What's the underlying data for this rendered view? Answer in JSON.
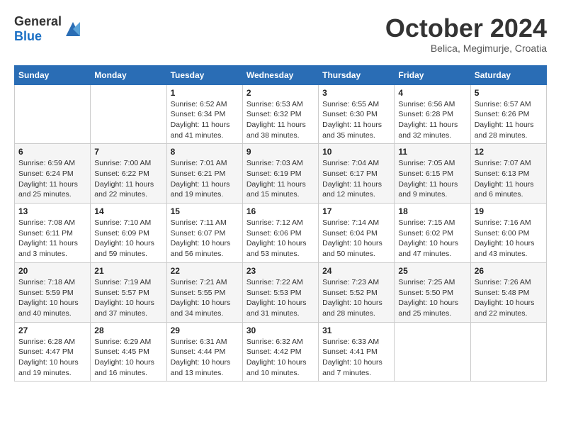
{
  "header": {
    "logo_general": "General",
    "logo_blue": "Blue",
    "month": "October 2024",
    "location": "Belica, Megimurje, Croatia"
  },
  "days_of_week": [
    "Sunday",
    "Monday",
    "Tuesday",
    "Wednesday",
    "Thursday",
    "Friday",
    "Saturday"
  ],
  "weeks": [
    [
      {
        "day": null
      },
      {
        "day": null
      },
      {
        "day": "1",
        "sunrise": "6:52 AM",
        "sunset": "6:34 PM",
        "daylight": "11 hours and 41 minutes."
      },
      {
        "day": "2",
        "sunrise": "6:53 AM",
        "sunset": "6:32 PM",
        "daylight": "11 hours and 38 minutes."
      },
      {
        "day": "3",
        "sunrise": "6:55 AM",
        "sunset": "6:30 PM",
        "daylight": "11 hours and 35 minutes."
      },
      {
        "day": "4",
        "sunrise": "6:56 AM",
        "sunset": "6:28 PM",
        "daylight": "11 hours and 32 minutes."
      },
      {
        "day": "5",
        "sunrise": "6:57 AM",
        "sunset": "6:26 PM",
        "daylight": "11 hours and 28 minutes."
      }
    ],
    [
      {
        "day": "6",
        "sunrise": "6:59 AM",
        "sunset": "6:24 PM",
        "daylight": "11 hours and 25 minutes."
      },
      {
        "day": "7",
        "sunrise": "7:00 AM",
        "sunset": "6:22 PM",
        "daylight": "11 hours and 22 minutes."
      },
      {
        "day": "8",
        "sunrise": "7:01 AM",
        "sunset": "6:21 PM",
        "daylight": "11 hours and 19 minutes."
      },
      {
        "day": "9",
        "sunrise": "7:03 AM",
        "sunset": "6:19 PM",
        "daylight": "11 hours and 15 minutes."
      },
      {
        "day": "10",
        "sunrise": "7:04 AM",
        "sunset": "6:17 PM",
        "daylight": "11 hours and 12 minutes."
      },
      {
        "day": "11",
        "sunrise": "7:05 AM",
        "sunset": "6:15 PM",
        "daylight": "11 hours and 9 minutes."
      },
      {
        "day": "12",
        "sunrise": "7:07 AM",
        "sunset": "6:13 PM",
        "daylight": "11 hours and 6 minutes."
      }
    ],
    [
      {
        "day": "13",
        "sunrise": "7:08 AM",
        "sunset": "6:11 PM",
        "daylight": "11 hours and 3 minutes."
      },
      {
        "day": "14",
        "sunrise": "7:10 AM",
        "sunset": "6:09 PM",
        "daylight": "10 hours and 59 minutes."
      },
      {
        "day": "15",
        "sunrise": "7:11 AM",
        "sunset": "6:07 PM",
        "daylight": "10 hours and 56 minutes."
      },
      {
        "day": "16",
        "sunrise": "7:12 AM",
        "sunset": "6:06 PM",
        "daylight": "10 hours and 53 minutes."
      },
      {
        "day": "17",
        "sunrise": "7:14 AM",
        "sunset": "6:04 PM",
        "daylight": "10 hours and 50 minutes."
      },
      {
        "day": "18",
        "sunrise": "7:15 AM",
        "sunset": "6:02 PM",
        "daylight": "10 hours and 47 minutes."
      },
      {
        "day": "19",
        "sunrise": "7:16 AM",
        "sunset": "6:00 PM",
        "daylight": "10 hours and 43 minutes."
      }
    ],
    [
      {
        "day": "20",
        "sunrise": "7:18 AM",
        "sunset": "5:59 PM",
        "daylight": "10 hours and 40 minutes."
      },
      {
        "day": "21",
        "sunrise": "7:19 AM",
        "sunset": "5:57 PM",
        "daylight": "10 hours and 37 minutes."
      },
      {
        "day": "22",
        "sunrise": "7:21 AM",
        "sunset": "5:55 PM",
        "daylight": "10 hours and 34 minutes."
      },
      {
        "day": "23",
        "sunrise": "7:22 AM",
        "sunset": "5:53 PM",
        "daylight": "10 hours and 31 minutes."
      },
      {
        "day": "24",
        "sunrise": "7:23 AM",
        "sunset": "5:52 PM",
        "daylight": "10 hours and 28 minutes."
      },
      {
        "day": "25",
        "sunrise": "7:25 AM",
        "sunset": "5:50 PM",
        "daylight": "10 hours and 25 minutes."
      },
      {
        "day": "26",
        "sunrise": "7:26 AM",
        "sunset": "5:48 PM",
        "daylight": "10 hours and 22 minutes."
      }
    ],
    [
      {
        "day": "27",
        "sunrise": "6:28 AM",
        "sunset": "4:47 PM",
        "daylight": "10 hours and 19 minutes."
      },
      {
        "day": "28",
        "sunrise": "6:29 AM",
        "sunset": "4:45 PM",
        "daylight": "10 hours and 16 minutes."
      },
      {
        "day": "29",
        "sunrise": "6:31 AM",
        "sunset": "4:44 PM",
        "daylight": "10 hours and 13 minutes."
      },
      {
        "day": "30",
        "sunrise": "6:32 AM",
        "sunset": "4:42 PM",
        "daylight": "10 hours and 10 minutes."
      },
      {
        "day": "31",
        "sunrise": "6:33 AM",
        "sunset": "4:41 PM",
        "daylight": "10 hours and 7 minutes."
      },
      {
        "day": null
      },
      {
        "day": null
      }
    ]
  ]
}
